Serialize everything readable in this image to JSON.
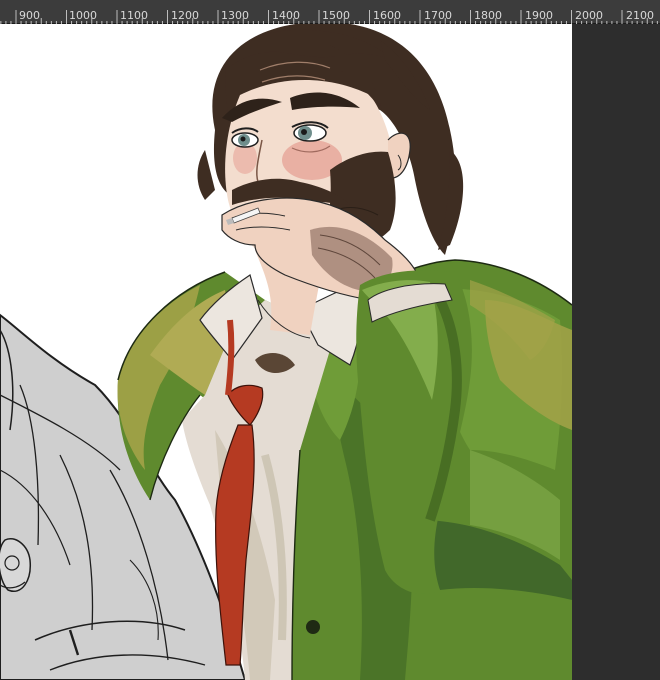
{
  "ruler": {
    "labels": [
      "900",
      "1000",
      "1100",
      "1200",
      "1300",
      "1400",
      "1500",
      "1600",
      "1700",
      "1800",
      "1900",
      "2000",
      "2100"
    ]
  },
  "colors": {
    "ruler_bg": "#3c3c3c",
    "ruler_text": "#d8d8d8",
    "canvas_bg": "#ffffff",
    "pasteboard_bg": "#2d2d2d",
    "jacket": "#5f8a2e",
    "tie": "#b53a22",
    "hair": "#3e2d22",
    "skin": "#f3ddce"
  },
  "artwork": {
    "subject": "digital illustration of a man with a mustache and beard smoking a cigarette, wearing a green jacket, white shirt and red tie, next to an uncolored sketch of a second figure"
  }
}
